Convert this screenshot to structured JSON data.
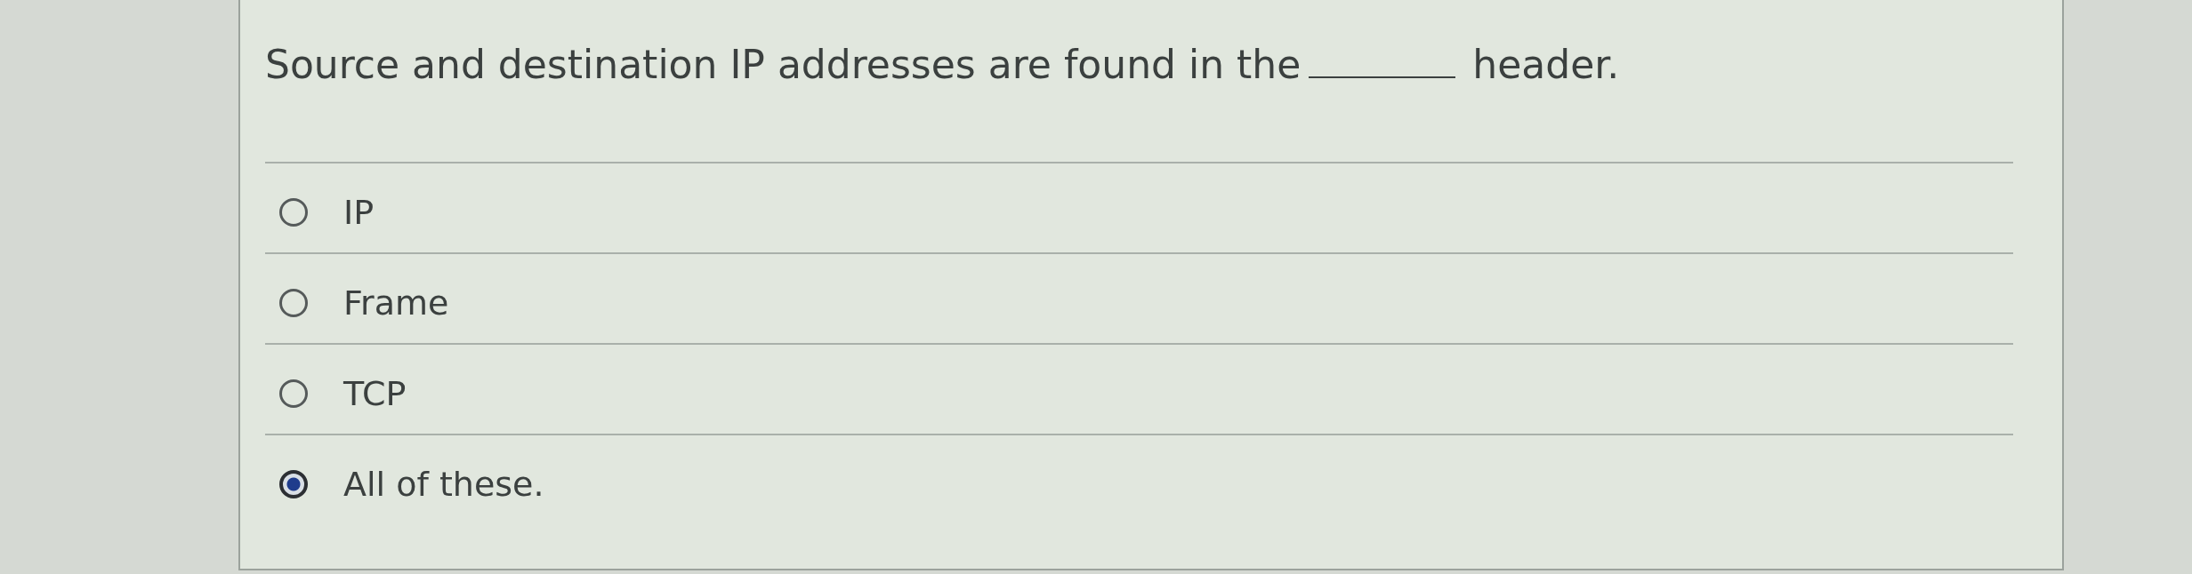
{
  "question": {
    "parts": [
      {
        "kind": "text",
        "text": "Source and destination IP addresses are found in the"
      },
      {
        "kind": "blank"
      },
      {
        "kind": "text",
        "text": "header."
      }
    ]
  },
  "options": [
    {
      "label": "IP",
      "selected": false
    },
    {
      "label": "Frame",
      "selected": false
    },
    {
      "label": "TCP",
      "selected": false
    },
    {
      "label": "All of these.",
      "selected": true
    }
  ]
}
